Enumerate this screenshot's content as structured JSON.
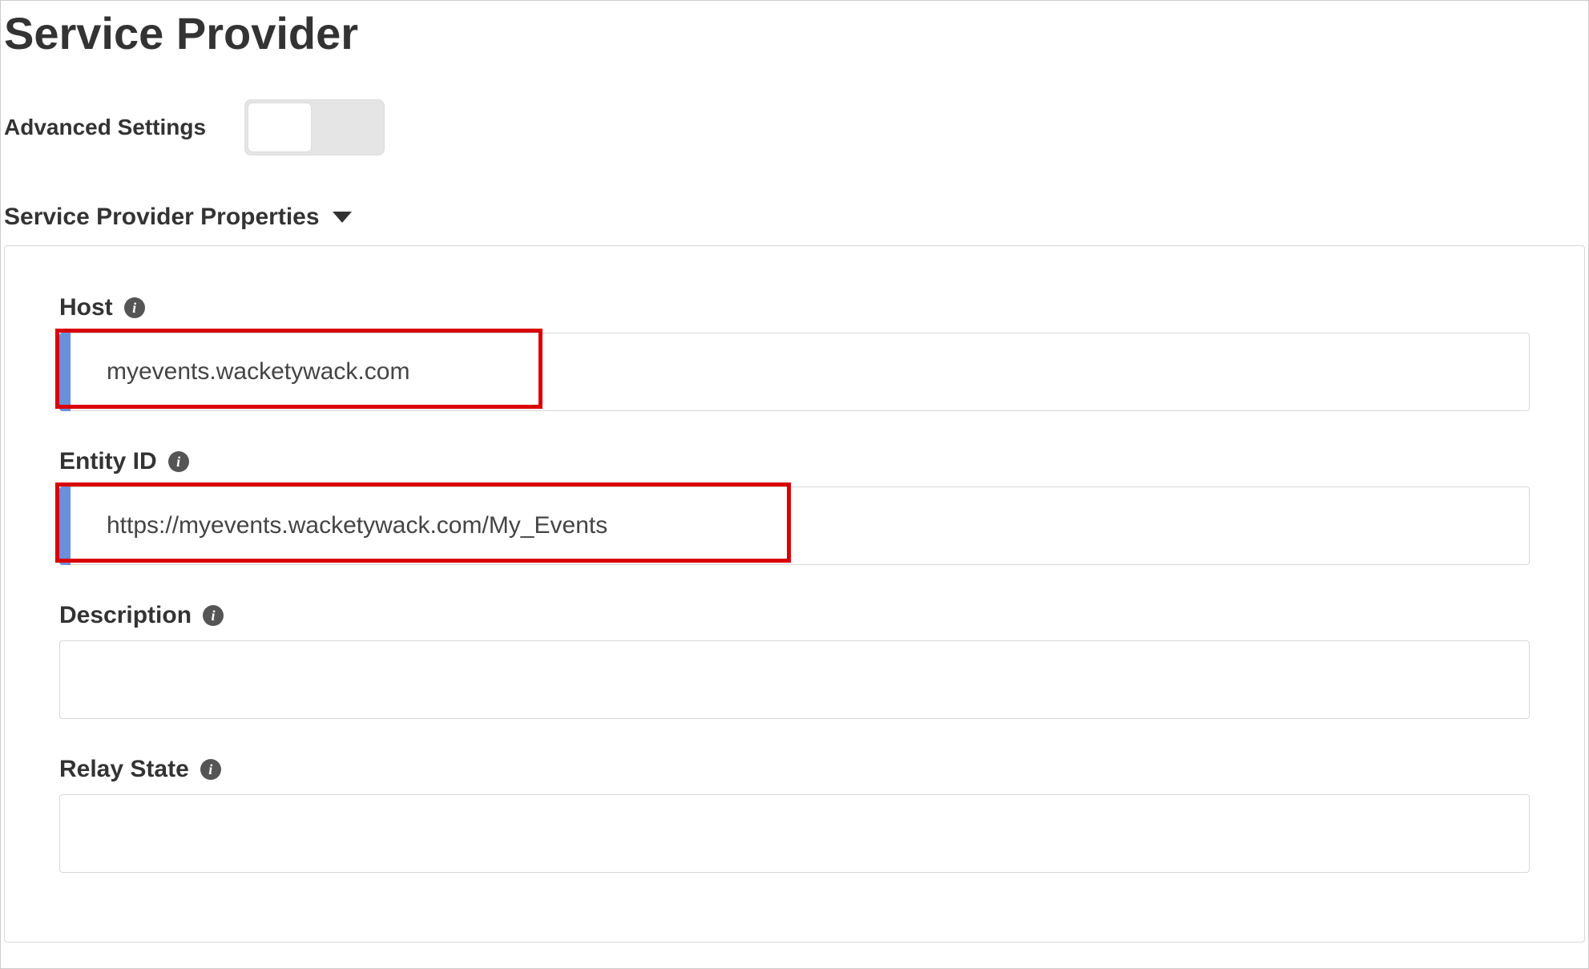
{
  "page": {
    "title": "Service Provider"
  },
  "advanced": {
    "label": "Advanced Settings",
    "toggle_on": false
  },
  "section": {
    "title": "Service Provider Properties"
  },
  "fields": {
    "host": {
      "label": "Host",
      "value": "myevents.wacketywack.com",
      "highlighted": true
    },
    "entity_id": {
      "label": "Entity ID",
      "value": "https://myevents.wacketywack.com/My_Events",
      "highlighted": true
    },
    "description": {
      "label": "Description",
      "value": ""
    },
    "relay_state": {
      "label": "Relay State",
      "value": ""
    }
  }
}
